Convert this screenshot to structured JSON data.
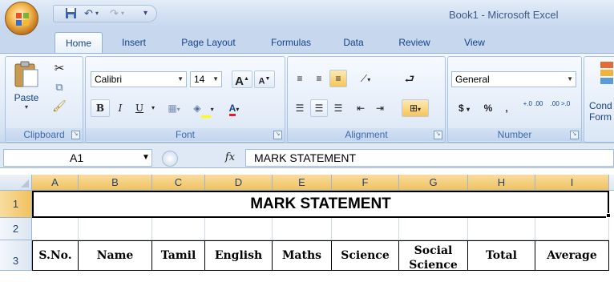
{
  "window": {
    "title": "Book1 - Microsoft Excel"
  },
  "qat": {
    "save_icon": "save-icon",
    "undo_icon": "undo-icon",
    "redo_icon": "redo-icon"
  },
  "tabs": [
    "Home",
    "Insert",
    "Page Layout",
    "Formulas",
    "Data",
    "Review",
    "View"
  ],
  "ribbon": {
    "clipboard": {
      "paste": "Paste",
      "label": "Clipboard"
    },
    "font": {
      "name": "Calibri",
      "size": "14",
      "label": "Font",
      "bold": "B",
      "italic": "I",
      "underline": "U",
      "grow": "A",
      "shrink": "A",
      "font_color": "A"
    },
    "alignment": {
      "label": "Alignment"
    },
    "number": {
      "format": "General",
      "label": "Number",
      "currency": "$",
      "percent": "%",
      "comma": ",",
      "inc_decimal": "+.0 .00",
      "dec_decimal": ".00 >.0"
    },
    "styles": {
      "cond_line1": "Cond",
      "cond_line2": "Form"
    }
  },
  "formula_bar": {
    "name_box": "A1",
    "fx": "fx",
    "content": "MARK STATEMENT"
  },
  "grid": {
    "columns": [
      "A",
      "B",
      "C",
      "D",
      "E",
      "F",
      "G",
      "H",
      "I"
    ],
    "rows": [
      "1",
      "2",
      "3"
    ],
    "title": "MARK STATEMENT",
    "headers": [
      "S.No.",
      "Name",
      "Tamil",
      "English",
      "Maths",
      "Science",
      "Social Science",
      "Total",
      "Average"
    ]
  },
  "colors": {
    "accent": "#15428b",
    "selected_header": "#f1c15f",
    "ribbon_bg": "#dfe8f5"
  }
}
